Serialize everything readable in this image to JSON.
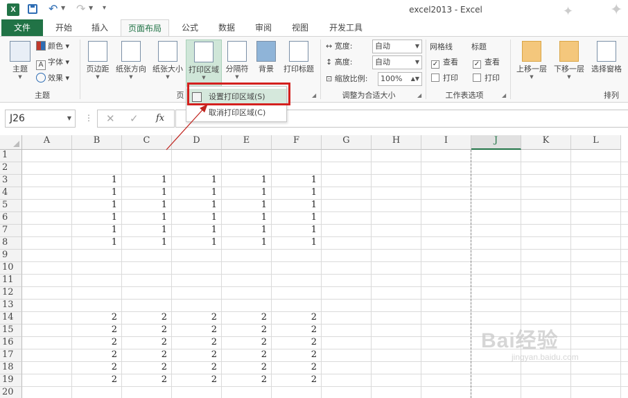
{
  "titlebar": {
    "app_icon": "X",
    "title": "excel2013 - Excel",
    "icons": [
      "excel-app-icon",
      "save-icon",
      "undo-icon",
      "redo-icon",
      "customize-quick-access-icon"
    ]
  },
  "tabs": [
    {
      "label": "文件"
    },
    {
      "label": "开始"
    },
    {
      "label": "插入"
    },
    {
      "label": "页面布局",
      "active": true
    },
    {
      "label": "公式"
    },
    {
      "label": "数据"
    },
    {
      "label": "审阅"
    },
    {
      "label": "视图"
    },
    {
      "label": "开发工具"
    }
  ],
  "ribbon": {
    "theme_group": {
      "theme_btn": "主题",
      "colors_btn": "颜色",
      "fonts_btn": "字体",
      "effects_btn": "效果",
      "label": "主题"
    },
    "page_setup_group": {
      "margins_btn": "页边距",
      "orientation_btn": "纸张方向",
      "size_btn": "纸张大小",
      "print_area_btn": "打印区域",
      "breaks_btn": "分隔符",
      "background_btn": "背景",
      "print_titles_btn": "打印标题",
      "label": "页"
    },
    "scale_group": {
      "width_label": "宽度:",
      "width_value": "自动",
      "height_label": "高度:",
      "height_value": "自动",
      "scale_label": "缩放比例:",
      "scale_value": "100%",
      "label": "调整为合适大小"
    },
    "sheet_options_group": {
      "gridlines_head": "网格线",
      "gridlines_view": "查看",
      "gridlines_print": "打印",
      "headings_head": "标题",
      "headings_view": "查看",
      "headings_print": "打印",
      "label": "工作表选项",
      "gridlines_view_checked": true,
      "gridlines_print_checked": false,
      "headings_view_checked": true,
      "headings_print_checked": false
    },
    "arrange_group": {
      "bring_forward_btn": "上移一层",
      "send_backward_btn": "下移一层",
      "selection_pane_btn": "选择窗格",
      "label": "排列"
    }
  },
  "dropdown_menu": {
    "set_print_area": "设置打印区域(S)",
    "clear_print_area": "取消打印区域(C)"
  },
  "formula_bar": {
    "name_box": "J26",
    "fx": "fx",
    "cancel": "✕",
    "enter": "✓",
    "formula": ""
  },
  "sheet": {
    "columns": [
      "A",
      "B",
      "C",
      "D",
      "E",
      "F",
      "G",
      "H",
      "I",
      "J",
      "K",
      "L"
    ],
    "selected_column": "J",
    "rows": [
      "1",
      "2",
      "3",
      "4",
      "5",
      "6",
      "7",
      "8",
      "9",
      "10",
      "11",
      "12",
      "13",
      "14",
      "15",
      "16",
      "17",
      "18",
      "19",
      "20"
    ],
    "cells": {
      "3": [
        "",
        "1",
        "1",
        "1",
        "1",
        "1"
      ],
      "4": [
        "",
        "1",
        "1",
        "1",
        "1",
        "1"
      ],
      "5": [
        "",
        "1",
        "1",
        "1",
        "1",
        "1"
      ],
      "6": [
        "",
        "1",
        "1",
        "1",
        "1",
        "1"
      ],
      "7": [
        "",
        "1",
        "1",
        "1",
        "1",
        "1"
      ],
      "8": [
        "",
        "1",
        "1",
        "1",
        "1",
        "1"
      ],
      "14": [
        "",
        "2",
        "2",
        "2",
        "2",
        "2"
      ],
      "15": [
        "",
        "2",
        "2",
        "2",
        "2",
        "2"
      ],
      "16": [
        "",
        "2",
        "2",
        "2",
        "2",
        "2"
      ],
      "17": [
        "",
        "2",
        "2",
        "2",
        "2",
        "2"
      ],
      "18": [
        "",
        "2",
        "2",
        "2",
        "2",
        "2"
      ],
      "19": [
        "",
        "2",
        "2",
        "2",
        "2",
        "2"
      ]
    }
  },
  "watermark": {
    "main": "Bai经验",
    "sub": "jingyan.baidu.com"
  },
  "colors": {
    "excel_green": "#217346",
    "highlight_red": "#d4201e",
    "menu_hover": "#d5e8dc"
  }
}
